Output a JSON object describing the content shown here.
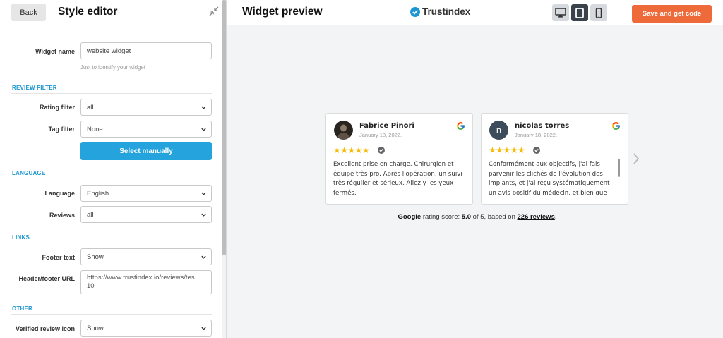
{
  "sidebar": {
    "back_label": "Back",
    "title": "Style editor",
    "collapse_icon": "collapse-arrows-icon",
    "widget_name": {
      "label": "Widget name",
      "value": "website widget",
      "hint": "Just to identify your widget"
    },
    "review_filter": {
      "title": "REVIEW FILTER",
      "rating_filter": {
        "label": "Rating filter",
        "value": "all"
      },
      "tag_filter": {
        "label": "Tag filter",
        "value": "None"
      },
      "select_manually_label": "Select manually"
    },
    "language": {
      "title": "LANGUAGE",
      "language": {
        "label": "Language",
        "value": "English"
      },
      "reviews": {
        "label": "Reviews",
        "value": "all"
      }
    },
    "links": {
      "title": "LINKS",
      "footer_text": {
        "label": "Footer text",
        "value": "Show"
      },
      "header_footer_url": {
        "label": "Header/footer URL",
        "value_line1": "https://www.trustindex.io/reviews/tes",
        "value_line2": "10"
      }
    },
    "other": {
      "title": "OTHER",
      "verified_review_icon": {
        "label": "Verified review icon",
        "value": "Show"
      }
    }
  },
  "topbar": {
    "title": "Widget preview",
    "brand": "Trustindex",
    "devices": [
      "desktop-icon",
      "tablet-icon",
      "mobile-icon"
    ],
    "active_device": "tablet",
    "save_label": "Save and get code"
  },
  "reviews": [
    {
      "name": "Fabrice Pinori",
      "date": "January 18, 2022.",
      "stars": "★★★★★",
      "text": "Excellent prise en charge. Chirurgien et équipe très pro. Après l'opération, un suivi très régulier et sérieux. Allez y les yeux fermés.",
      "avatar_initial": ""
    },
    {
      "name": "nicolas torres",
      "date": "January 18, 2022.",
      "stars": "★★★★★",
      "text": "Conformément aux objectifs, j'ai fais parvenir les clichés de l'évolution des implants, et j'ai reçu systématiquement un avis positif du médecin, et bien que",
      "avatar_initial": "n"
    }
  ],
  "rating": {
    "source": "Google",
    "label": " rating score: ",
    "score": "5.0",
    "of": " of 5, based on ",
    "count": "226 reviews",
    "end": "."
  },
  "colors": {
    "accent": "#25a3dc",
    "save": "#ee6a3a",
    "star": "#f6bb06",
    "section": "#1c97d3"
  }
}
